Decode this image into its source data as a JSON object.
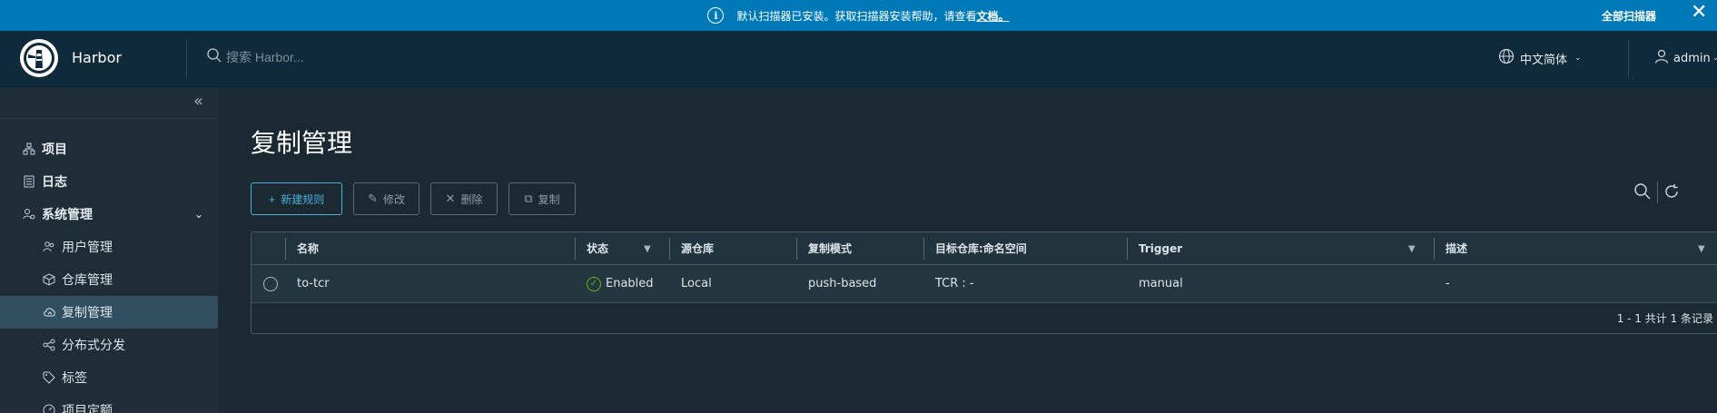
{
  "banner": {
    "message": "默认扫描器已安装。获取扫描器安装帮助，请查看 ",
    "link": "文档。",
    "scan_all": "全部扫描器",
    "close": "✕"
  },
  "header": {
    "app_title": "Harbor",
    "search_placeholder": "搜索 Harbor...",
    "language": "中文简体",
    "user": "admin"
  },
  "sidebar": {
    "collapse": "«",
    "items": [
      {
        "label": "项目",
        "icon": "projects-icon"
      },
      {
        "label": "日志",
        "icon": "logs-icon"
      },
      {
        "label": "系统管理",
        "icon": "admin-icon",
        "expanded": true
      },
      {
        "label": "用户管理",
        "icon": "users-icon"
      },
      {
        "label": "仓库管理",
        "icon": "registry-icon"
      },
      {
        "label": "复制管理",
        "icon": "replication-icon",
        "active": true
      },
      {
        "label": "分布式分发",
        "icon": "distribution-icon"
      },
      {
        "label": "标签",
        "icon": "tag-icon"
      },
      {
        "label": "项目定额",
        "icon": "quota-icon"
      }
    ]
  },
  "main": {
    "title": "复制管理",
    "toolbar": {
      "new_rule": "新建规则",
      "edit": "修改",
      "delete": "删除",
      "copy": "复制"
    },
    "table": {
      "columns": [
        "名称",
        "状态",
        "源仓库",
        "复制模式",
        "目标仓库:命名空间",
        "Trigger",
        "描述"
      ],
      "rows": [
        {
          "name": "to-tcr",
          "status": "Enabled",
          "source": "Local",
          "mode": "push-based",
          "target": "TCR : -",
          "trigger": "manual",
          "description": "-"
        }
      ],
      "footer": "1 - 1 共计 1 条记录"
    }
  },
  "colors": {
    "banner": "#0079b8",
    "header": "#0f2a3a",
    "sidebar": "#1f2e36",
    "active_nav": "#324f62",
    "primary": "#4aaed9",
    "success": "#60b515"
  }
}
